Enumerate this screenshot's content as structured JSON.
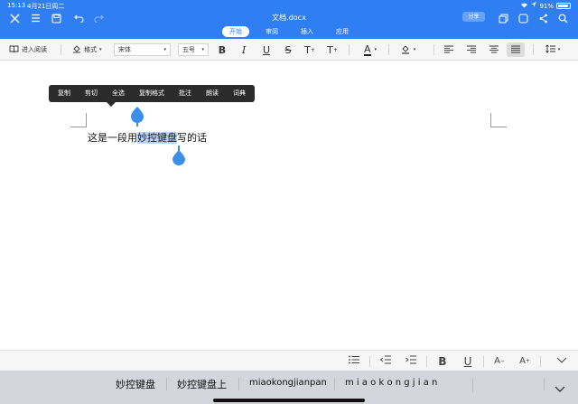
{
  "status": {
    "time": "15:13",
    "date": "4月21日周二",
    "battery": "91%"
  },
  "header": {
    "doc_title": "文档.docx",
    "share_label": "分享",
    "tabs": [
      "开始",
      "审阅",
      "插入",
      "应用"
    ],
    "active_tab": "开始"
  },
  "ribbon": {
    "read_mode_label": "进入阅读",
    "format_label": "格式",
    "font_name": "宋体",
    "font_size": "五号",
    "bold": "B",
    "italic": "I",
    "underline": "U",
    "strike": "S",
    "superscript": "T",
    "subscript": "T",
    "font_color_letter": "A",
    "font_color": "#222222",
    "accent": "#2f7ef2"
  },
  "context_menu": {
    "items": [
      "复制",
      "剪切",
      "全选",
      "复制格式",
      "批注",
      "朗读",
      "词典"
    ]
  },
  "document": {
    "text_before": "这是一段用",
    "text_selected": "妙控键盘",
    "text_after": "写的话"
  },
  "keyboard_toolbar": {
    "bold": "B",
    "underline": "U",
    "font_down": "A",
    "font_up": "A"
  },
  "candidates": {
    "items": [
      "妙控键盘",
      "妙控键盘上",
      "miaokongjianpan"
    ],
    "pinyin": "m i a o k o n g j i a n"
  }
}
